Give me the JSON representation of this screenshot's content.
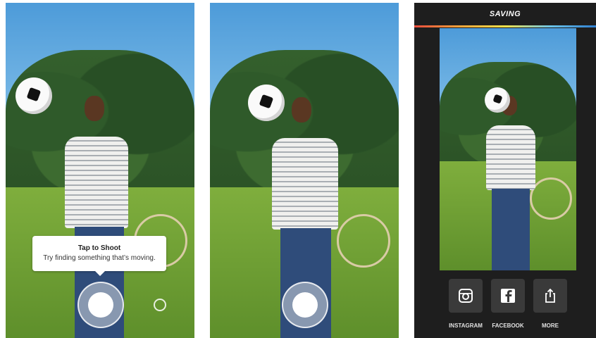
{
  "screen1": {
    "tooltip": {
      "title": "Tap to Shoot",
      "text": "Try finding something that’s moving."
    }
  },
  "screen3": {
    "header": {
      "title": "SAVING"
    },
    "share_buttons": [
      {
        "label": "INSTAGRAM",
        "icon": "instagram-icon"
      },
      {
        "label": "FACEBOOK",
        "icon": "facebook-icon"
      },
      {
        "label": "MORE",
        "icon": "share-icon"
      }
    ]
  },
  "colors": {
    "sky": "#4d9bd9",
    "grass": "#6fa035",
    "dark_panel": "#1e1e1e",
    "button_bg": "#3a3a3a"
  }
}
